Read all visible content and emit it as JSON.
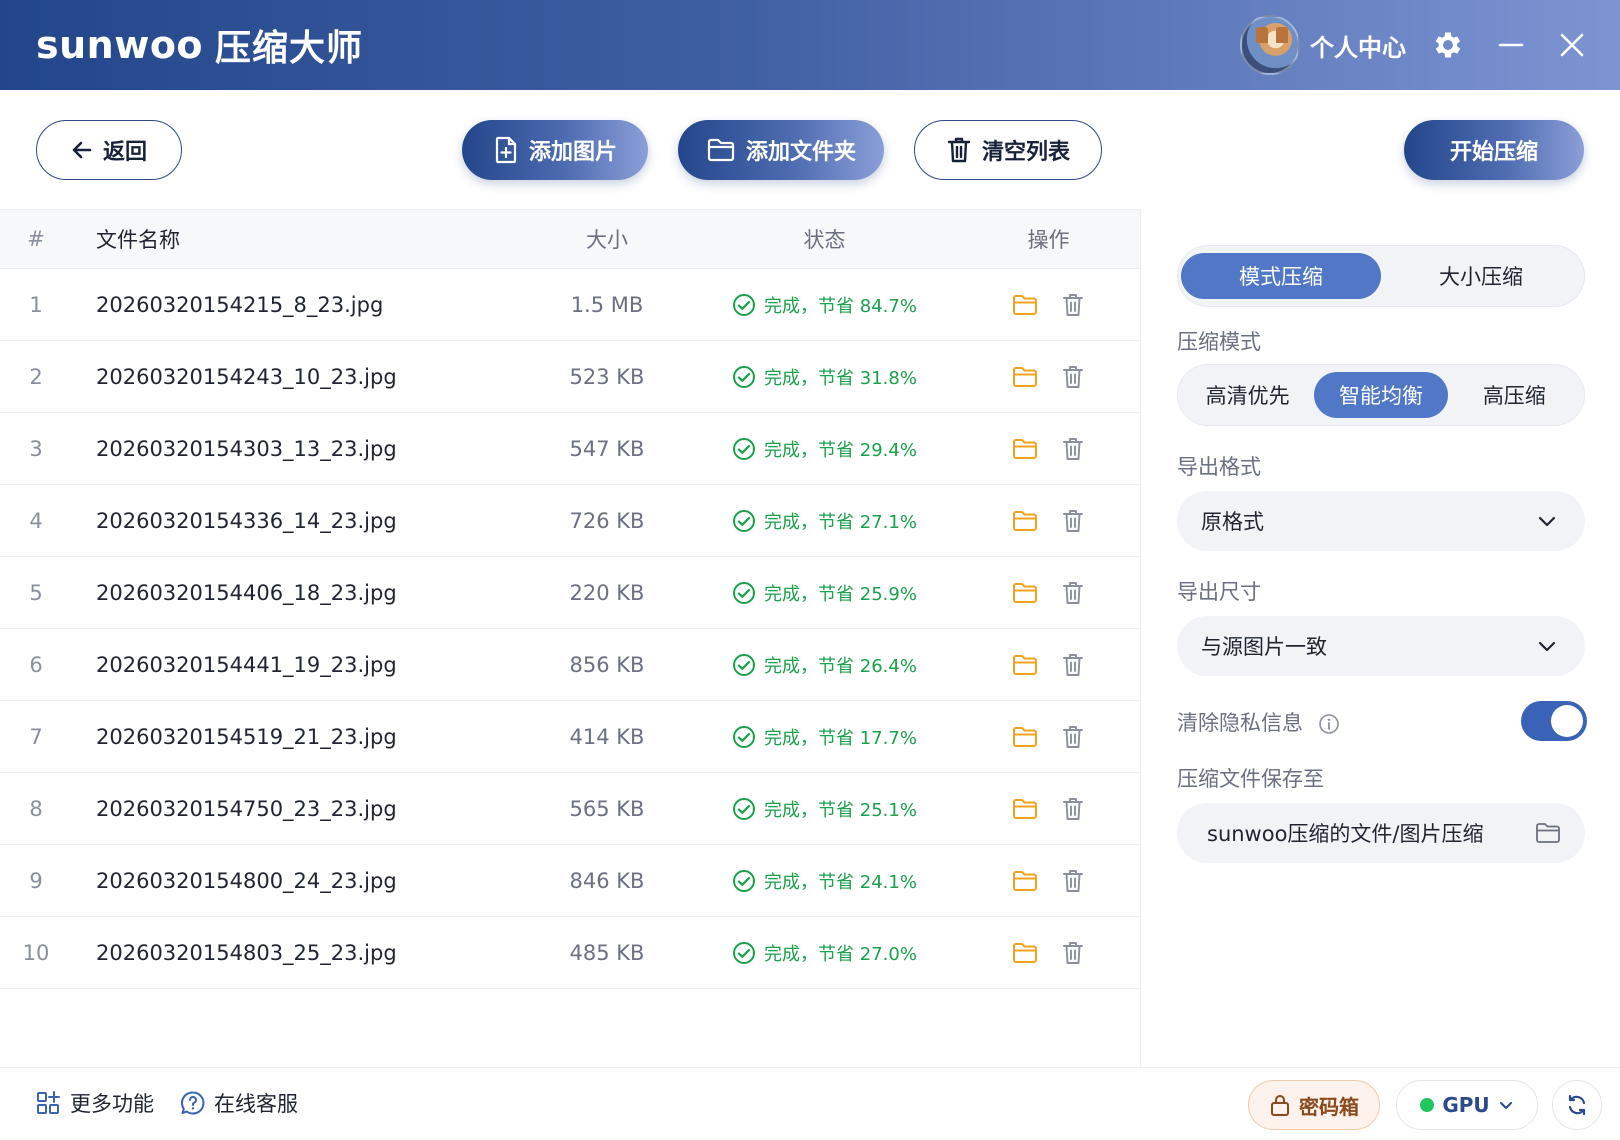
{
  "app": {
    "brand_en": "sunwoo",
    "brand_cn": "压缩大师",
    "user_label": "个人中心"
  },
  "toolbar": {
    "back_label": "返回",
    "add_image_label": "添加图片",
    "add_folder_label": "添加文件夹",
    "clear_label": "清空列表",
    "start_label": "开始压缩"
  },
  "table": {
    "headers": {
      "index": "#",
      "name": "文件名称",
      "size": "大小",
      "status": "状态",
      "ops": "操作"
    },
    "rows": [
      {
        "index": "1",
        "name": "20260320154215_8_23.jpg",
        "size": "1.5 MB",
        "status": "完成，节省 84.7%"
      },
      {
        "index": "2",
        "name": "20260320154243_10_23.jpg",
        "size": "523 KB",
        "status": "完成，节省 31.8%"
      },
      {
        "index": "3",
        "name": "20260320154303_13_23.jpg",
        "size": "547 KB",
        "status": "完成，节省 29.4%"
      },
      {
        "index": "4",
        "name": "20260320154336_14_23.jpg",
        "size": "726 KB",
        "status": "完成，节省 27.1%"
      },
      {
        "index": "5",
        "name": "20260320154406_18_23.jpg",
        "size": "220 KB",
        "status": "完成，节省 25.9%"
      },
      {
        "index": "6",
        "name": "20260320154441_19_23.jpg",
        "size": "856 KB",
        "status": "完成，节省 26.4%"
      },
      {
        "index": "7",
        "name": "20260320154519_21_23.jpg",
        "size": "414 KB",
        "status": "完成，节省 17.7%"
      },
      {
        "index": "8",
        "name": "20260320154750_23_23.jpg",
        "size": "565 KB",
        "status": "完成，节省 25.1%"
      },
      {
        "index": "9",
        "name": "20260320154800_24_23.jpg",
        "size": "846 KB",
        "status": "完成，节省 24.1%"
      },
      {
        "index": "10",
        "name": "20260320154803_25_23.jpg",
        "size": "485 KB",
        "status": "完成，节省 27.0%"
      }
    ]
  },
  "panel": {
    "tabs": [
      {
        "label": "模式压缩",
        "active": true
      },
      {
        "label": "大小压缩",
        "active": false
      }
    ],
    "mode_label": "压缩模式",
    "modes": [
      {
        "label": "高清优先",
        "active": false
      },
      {
        "label": "智能均衡",
        "active": true
      },
      {
        "label": "高压缩",
        "active": false
      }
    ],
    "format_label": "导出格式",
    "format_value": "原格式",
    "size_label": "导出尺寸",
    "size_value": "与源图片一致",
    "privacy_label": "清除隐私信息",
    "privacy_enabled": true,
    "save_label": "压缩文件保存至",
    "save_path": "sunwoo压缩的文件/图片压缩"
  },
  "footer": {
    "more_label": "更多功能",
    "service_label": "在线客服",
    "vault_label": "密码箱",
    "gpu_label": "GPU"
  },
  "colors": {
    "accent": "#5177c7",
    "brand_dark": "#23468a",
    "success": "#19a14c",
    "folder": "#f0a21e",
    "gpu_dot": "#22c55e"
  }
}
